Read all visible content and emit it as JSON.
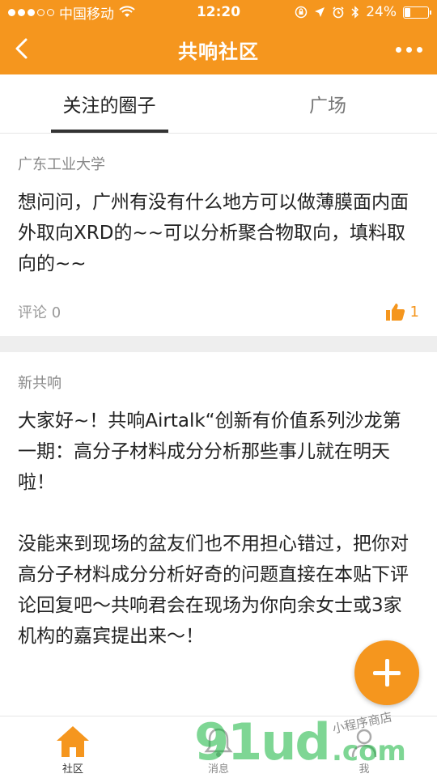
{
  "status_bar": {
    "carrier": "中国移动",
    "time": "12:20",
    "battery": "24%"
  },
  "nav": {
    "title": "共响社区"
  },
  "tabs": [
    {
      "label": "关注的圈子",
      "active": true
    },
    {
      "label": "广场",
      "active": false
    }
  ],
  "posts": [
    {
      "group": "广东工业大学",
      "paragraphs": [
        "想问问，广州有没有什么地方可以做薄膜面内面外取向XRD的~~可以分析聚合物取向，填料取向的~~"
      ],
      "comments_label": "评论 0",
      "likes": "1"
    },
    {
      "group": "新共响",
      "paragraphs": [
        "大家好~！共响Airtalk“创新有价值系列沙龙第一期：高分子材料成分分析那些事儿就在明天啦！",
        "没能来到现场的盆友们也不用担心错过，把你对高分子材料成分分析好奇的问题直接在本贴下评论回复吧～共响君会在现场为你向余女士或3家机构的嘉宾提出来～！"
      ]
    }
  ],
  "bottom_nav": [
    {
      "label": "社区",
      "icon": "home-icon",
      "active": true
    },
    {
      "label": "消息",
      "icon": "bell-icon",
      "active": false
    },
    {
      "label": "我",
      "icon": "person-icon",
      "active": false
    }
  ],
  "watermark": {
    "brand": "91ud",
    "domain": ".com",
    "tagline": "小程序商店"
  },
  "colors": {
    "accent": "#f5961e",
    "separator": "#eeeeee"
  }
}
